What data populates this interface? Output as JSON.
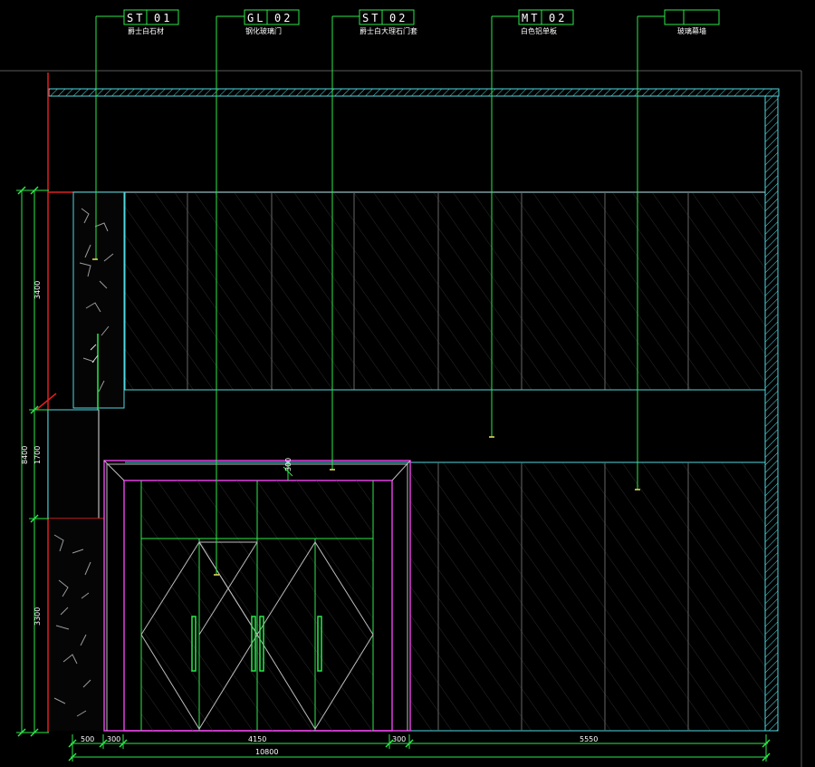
{
  "drawing": {
    "tags": [
      {
        "code": "ST",
        "number": "01",
        "note": "爵士白石材"
      },
      {
        "code": "GL",
        "number": "02",
        "note": "钢化玻璃门"
      },
      {
        "code": "ST",
        "number": "02",
        "note": "爵士白大理石门套"
      },
      {
        "code": "MT",
        "number": "02",
        "note": "白色铝单板"
      },
      {
        "code": "",
        "number": "",
        "note": "玻璃幕墙"
      }
    ],
    "dimensions": {
      "vertical_total": "8400",
      "vertical_upper": "3400",
      "vertical_middle": "1700",
      "vertical_lower": "3300",
      "door_trim_width": "300",
      "horizontal_total": "10800",
      "horizontal": [
        "500",
        "300",
        "4150",
        "300",
        "5550"
      ]
    }
  }
}
